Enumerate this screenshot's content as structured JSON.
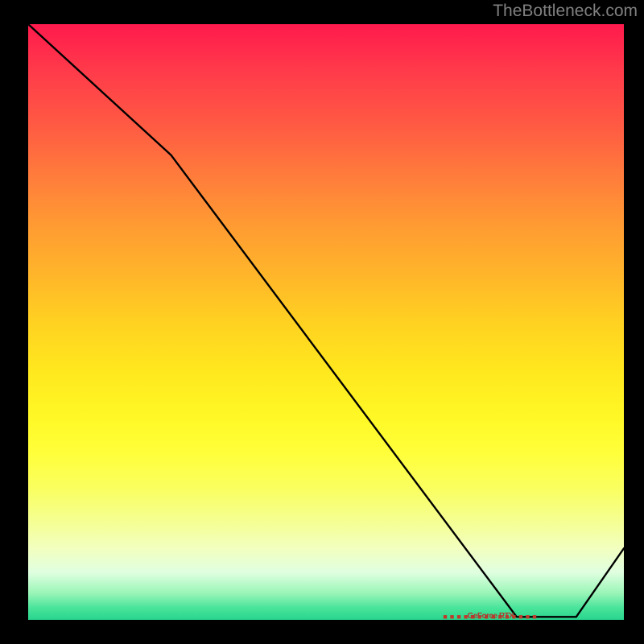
{
  "watermark": "TheBottleneck.com",
  "chart_data": {
    "type": "line",
    "title": "",
    "xlabel": "",
    "ylabel": "",
    "xlim": [
      0,
      100
    ],
    "ylim": [
      0,
      100
    ],
    "x": [
      0,
      24,
      82,
      92,
      100
    ],
    "values": [
      100,
      78,
      0.5,
      0.5,
      12
    ],
    "marker": {
      "x_start": 70,
      "x_end": 85,
      "y": 0.5,
      "label": "GeForce RTX"
    },
    "gradient_stops": [
      {
        "pos": 0,
        "color": "#ff1a4d"
      },
      {
        "pos": 8,
        "color": "#ff3b4a"
      },
      {
        "pos": 17,
        "color": "#ff5a43"
      },
      {
        "pos": 25,
        "color": "#ff7a3c"
      },
      {
        "pos": 33,
        "color": "#ff9833"
      },
      {
        "pos": 42,
        "color": "#ffb52a"
      },
      {
        "pos": 50,
        "color": "#ffd121"
      },
      {
        "pos": 58,
        "color": "#ffe71e"
      },
      {
        "pos": 66,
        "color": "#fff826"
      },
      {
        "pos": 72,
        "color": "#ffff3a"
      },
      {
        "pos": 78,
        "color": "#faff60"
      },
      {
        "pos": 83,
        "color": "#f5ff8e"
      },
      {
        "pos": 88,
        "color": "#f2ffbf"
      },
      {
        "pos": 92,
        "color": "#e0ffe0"
      },
      {
        "pos": 95.5,
        "color": "#9af5b8"
      },
      {
        "pos": 98,
        "color": "#49e49a"
      },
      {
        "pos": 100,
        "color": "#28d58e"
      }
    ]
  }
}
